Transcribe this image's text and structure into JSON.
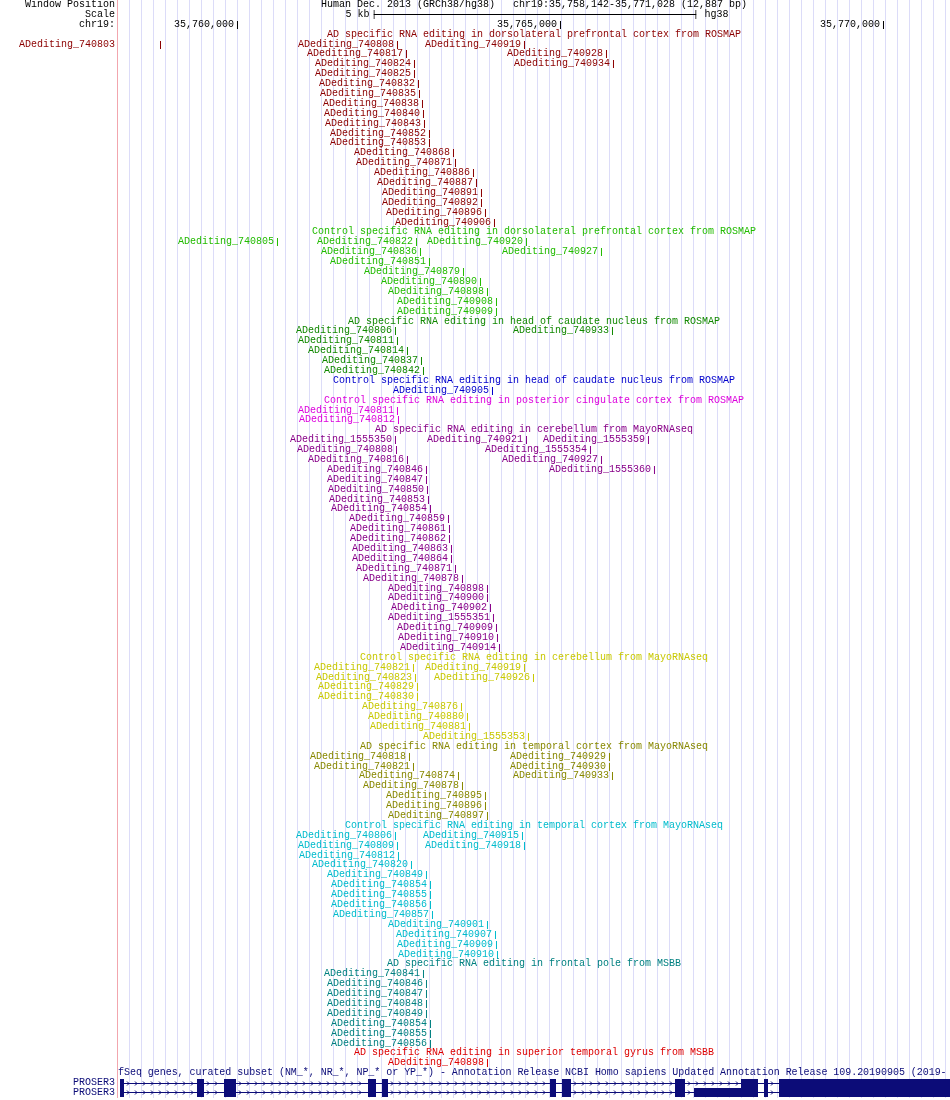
{
  "header": {
    "position_label": "Window Position",
    "assembly": "Human Dec. 2013 (GRCh38/hg38)",
    "position": "chr19:35,758,142-35,771,028 (12,887 bp)",
    "scale_label": "Scale",
    "scale": "5 kb",
    "genome": "hg38",
    "chrom_label": "chr19:",
    "ruler": [
      "35,760,000",
      "35,765,000",
      "35,770,000"
    ]
  },
  "tracks": [
    {
      "title": "AD specific RNA editing in dorsolateral prefrontal cortex from ROSMAP",
      "color": "#8c0000",
      "rows": [
        [
          "ADediting_740803",
          "ADediting_740808",
          "ADediting_740919"
        ],
        [
          "ADediting_740817",
          "ADediting_740928"
        ],
        [
          "ADediting_740824",
          "ADediting_740934"
        ],
        [
          "ADediting_740825"
        ],
        [
          "ADediting_740832"
        ],
        [
          "ADediting_740835"
        ],
        [
          "ADediting_740838"
        ],
        [
          "ADediting_740840"
        ],
        [
          "ADediting_740843"
        ],
        [
          "ADediting_740852"
        ],
        [
          "ADediting_740853"
        ],
        [
          "ADediting_740868"
        ],
        [
          "ADediting_740871"
        ],
        [
          "ADediting_740886"
        ],
        [
          "ADediting_740887"
        ],
        [
          "ADediting_740891"
        ],
        [
          "ADediting_740892"
        ],
        [
          "ADediting_740896"
        ],
        [
          "ADediting_740906"
        ]
      ]
    },
    {
      "title": "Control specific RNA editing in dorsolateral prefrontal cortex from ROSMAP",
      "color": "#22bb00",
      "rows": [
        [
          "ADediting_740805",
          "ADediting_740822",
          "ADediting_740920"
        ],
        [
          "ADediting_740836",
          "ADediting_740927"
        ],
        [
          "ADediting_740851"
        ],
        [
          "ADediting_740879"
        ],
        [
          "ADediting_740890"
        ],
        [
          "ADediting_740898"
        ],
        [
          "ADediting_740908"
        ],
        [
          "ADediting_740909"
        ]
      ]
    },
    {
      "title": "AD specific RNA editing in head of caudate nucleus from ROSMAP",
      "color": "#118800",
      "rows": [
        [
          "ADediting_740806",
          "ADediting_740933"
        ],
        [
          "ADediting_740811"
        ],
        [
          "ADediting_740814"
        ],
        [
          "ADediting_740837"
        ],
        [
          "ADediting_740842"
        ]
      ]
    },
    {
      "title": "Control specific RNA editing in head of caudate nucleus from ROSMAP",
      "color": "#0000cc",
      "rows": [
        [
          "ADediting_740905"
        ]
      ]
    },
    {
      "title": "Control specific RNA editing in posterior cingulate cortex from ROSMAP",
      "color": "#dd00dd",
      "rows": [
        [
          "ADediting_740811"
        ],
        [
          "ADediting_740812"
        ]
      ]
    },
    {
      "title": "AD specific RNA editing in cerebellum from MayoRNAseq",
      "color": "#880088",
      "rows": [
        [
          "ADediting_1555350",
          "ADediting_740921",
          "ADediting_1555359"
        ],
        [
          "ADediting_740808",
          "ADediting_1555354"
        ],
        [
          "ADediting_740816",
          "ADediting_740927"
        ],
        [
          "ADediting_740846",
          "ADediting_1555360"
        ],
        [
          "ADediting_740847"
        ],
        [
          "ADediting_740850"
        ],
        [
          "ADediting_740853"
        ],
        [
          "ADediting_740854"
        ],
        [
          "ADediting_740859"
        ],
        [
          "ADediting_740861"
        ],
        [
          "ADediting_740862"
        ],
        [
          "ADediting_740863"
        ],
        [
          "ADediting_740864"
        ],
        [
          "ADediting_740871"
        ],
        [
          "ADediting_740878"
        ],
        [
          "ADediting_740898"
        ],
        [
          "ADediting_740900"
        ],
        [
          "ADediting_740902"
        ],
        [
          "ADediting_1555351"
        ],
        [
          "ADediting_740909"
        ],
        [
          "ADediting_740910"
        ],
        [
          "ADediting_740914"
        ]
      ]
    },
    {
      "title": "Control specific RNA editing in cerebellum from MayoRNAseq",
      "color": "#c8c800",
      "rows": [
        [
          "ADediting_740821",
          "ADediting_740919"
        ],
        [
          "ADediting_740823",
          "ADediting_740926"
        ],
        [
          "ADediting_740829"
        ],
        [
          "ADediting_740830"
        ],
        [
          "ADediting_740876"
        ],
        [
          "ADediting_740880"
        ],
        [
          "ADediting_740881"
        ],
        [
          "ADediting_1555353"
        ]
      ]
    },
    {
      "title": "AD specific RNA editing in temporal cortex from MayoRNAseq",
      "color": "#888800",
      "rows": [
        [
          "ADediting_740818",
          "ADediting_740929"
        ],
        [
          "ADediting_740821",
          "ADediting_740930"
        ],
        [
          "ADediting_740874",
          "ADediting_740933"
        ],
        [
          "ADediting_740878"
        ],
        [
          "ADediting_740895"
        ],
        [
          "ADediting_740896"
        ],
        [
          "ADediting_740897"
        ]
      ]
    },
    {
      "title": "Control specific RNA editing in temporal cortex from MayoRNAseq",
      "color": "#00bbcc",
      "rows": [
        [
          "ADediting_740806",
          "ADediting_740915"
        ],
        [
          "ADediting_740809",
          "ADediting_740918"
        ],
        [
          "ADediting_740812"
        ],
        [
          "ADediting_740820"
        ],
        [
          "ADediting_740849"
        ],
        [
          "ADediting_740854"
        ],
        [
          "ADediting_740855"
        ],
        [
          "ADediting_740856"
        ],
        [
          "ADediting_740857"
        ],
        [
          "ADediting_740901"
        ],
        [
          "ADediting_740907"
        ],
        [
          "ADediting_740909"
        ],
        [
          "ADediting_740910"
        ]
      ]
    },
    {
      "title": "AD specific RNA editing in frontal pole from MSBB",
      "color": "#008080",
      "rows": [
        [
          "ADediting_740841"
        ],
        [
          "ADediting_740846"
        ],
        [
          "ADediting_740847"
        ],
        [
          "ADediting_740848"
        ],
        [
          "ADediting_740849"
        ],
        [
          "ADediting_740854"
        ],
        [
          "ADediting_740855"
        ],
        [
          "ADediting_740856"
        ]
      ]
    },
    {
      "title": "AD specific RNA editing in superior temporal gyrus from MSBB",
      "color": "#dd0000",
      "rows": [
        [
          "ADediting_740898"
        ]
      ]
    }
  ],
  "gene_track": {
    "title": "fSeq genes, curated subset (NM_*, NR_*, NP_* or YP_*) - Annotation Release NCBI Homo sapiens Updated Annotation Release 109.20190905 (2019-",
    "genes": [
      {
        "name": "PROSER3"
      },
      {
        "name": "PROSER3"
      }
    ]
  }
}
